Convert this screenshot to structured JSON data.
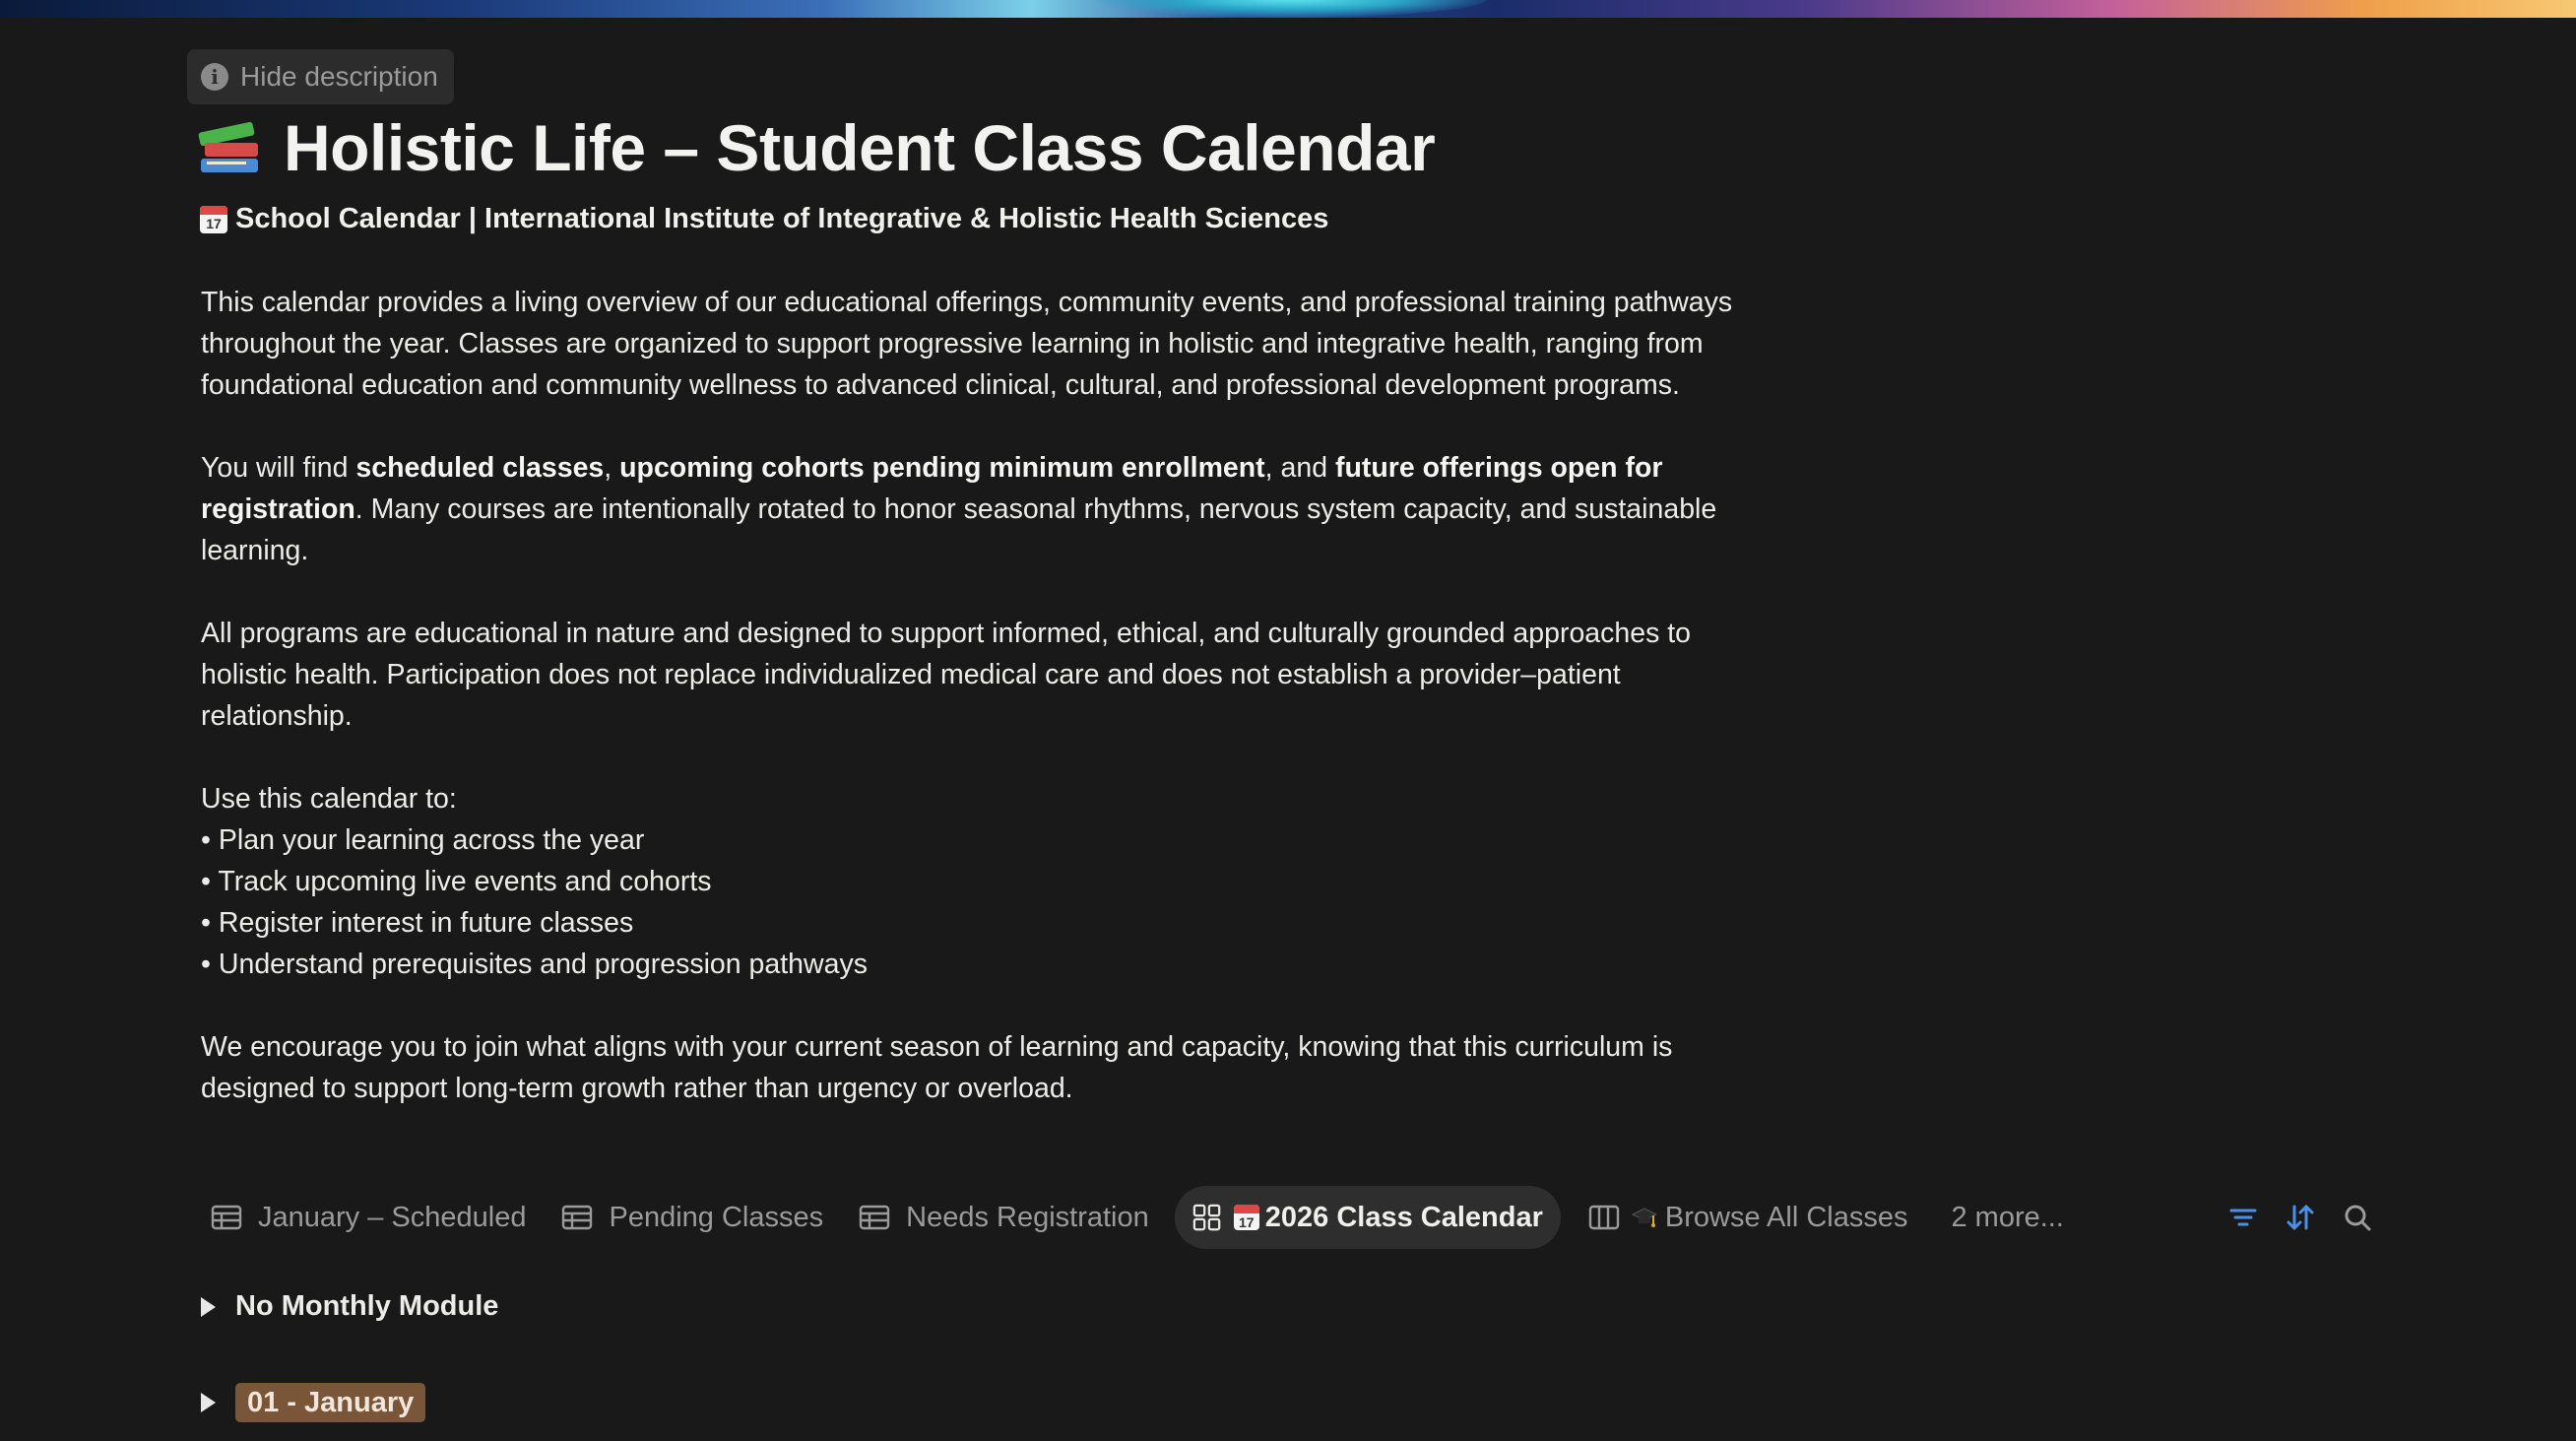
{
  "cover": {
    "colors": [
      "#0a1a3a",
      "#3b6fb8",
      "#5fe6f0",
      "#c4609a",
      "#f7c873"
    ]
  },
  "hide_description": {
    "label": "Hide description",
    "icon": "info-icon"
  },
  "page": {
    "title_icon": "books-icon",
    "title": "Holistic Life – Student Class Calendar",
    "subtitle_icon": "calendar-icon",
    "subtitle": "School Calendar | International Institute of Integrative & Holistic Health Sciences"
  },
  "description": {
    "p1": "This calendar provides a living overview of our educational offerings, community events, and professional training pathways throughout the year. Classes are organized to support progressive learning in holistic and integrative health, ranging from foundational education and community wellness to advanced clinical, cultural, and professional development programs.",
    "p2": {
      "t1": "You will find ",
      "b1": "scheduled classes",
      "t2": ", ",
      "b2": "upcoming cohorts pending minimum enrollment",
      "t3": ", and ",
      "b3": "future offerings open for registration",
      "t4": ". Many courses are intentionally rotated to honor seasonal rhythms, nervous system capacity, and sustainable learning."
    },
    "p3": "All programs are educational in nature and designed to support informed, ethical, and culturally grounded approaches to holistic health. Participation does not replace individualized medical care and does not establish a provider–patient relationship.",
    "p4_intro": "Use this calendar to:",
    "bullets": [
      "• Plan your learning across the year",
      "• Track upcoming live events and cohorts",
      "• Register interest in future classes",
      "• Understand prerequisites and progression pathways"
    ],
    "p5": "We encourage you to join what aligns with your current season of learning and capacity, knowing that this curriculum is designed to support long-term growth rather than urgency or overload."
  },
  "tabs": [
    {
      "label": "January – Scheduled",
      "icon": "table-icon"
    },
    {
      "label": "Pending Classes",
      "icon": "table-icon"
    },
    {
      "label": "Needs Registration",
      "icon": "table-icon"
    },
    {
      "label": "2026 Class Calendar",
      "icon": "gallery-icon",
      "emoji": "calendar-icon",
      "active": true
    },
    {
      "label": "Browse All Classes",
      "icon": "board-icon",
      "emoji": "graduation-cap-icon"
    }
  ],
  "more_tabs": "2 more...",
  "toolbar": {
    "accent": "#4a8fe8",
    "icons": [
      "filter-icon",
      "sort-icon",
      "search-icon"
    ]
  },
  "groups": [
    {
      "label": "No Monthly Module"
    },
    {
      "label": "01 - January",
      "color": "#7a5638"
    }
  ]
}
